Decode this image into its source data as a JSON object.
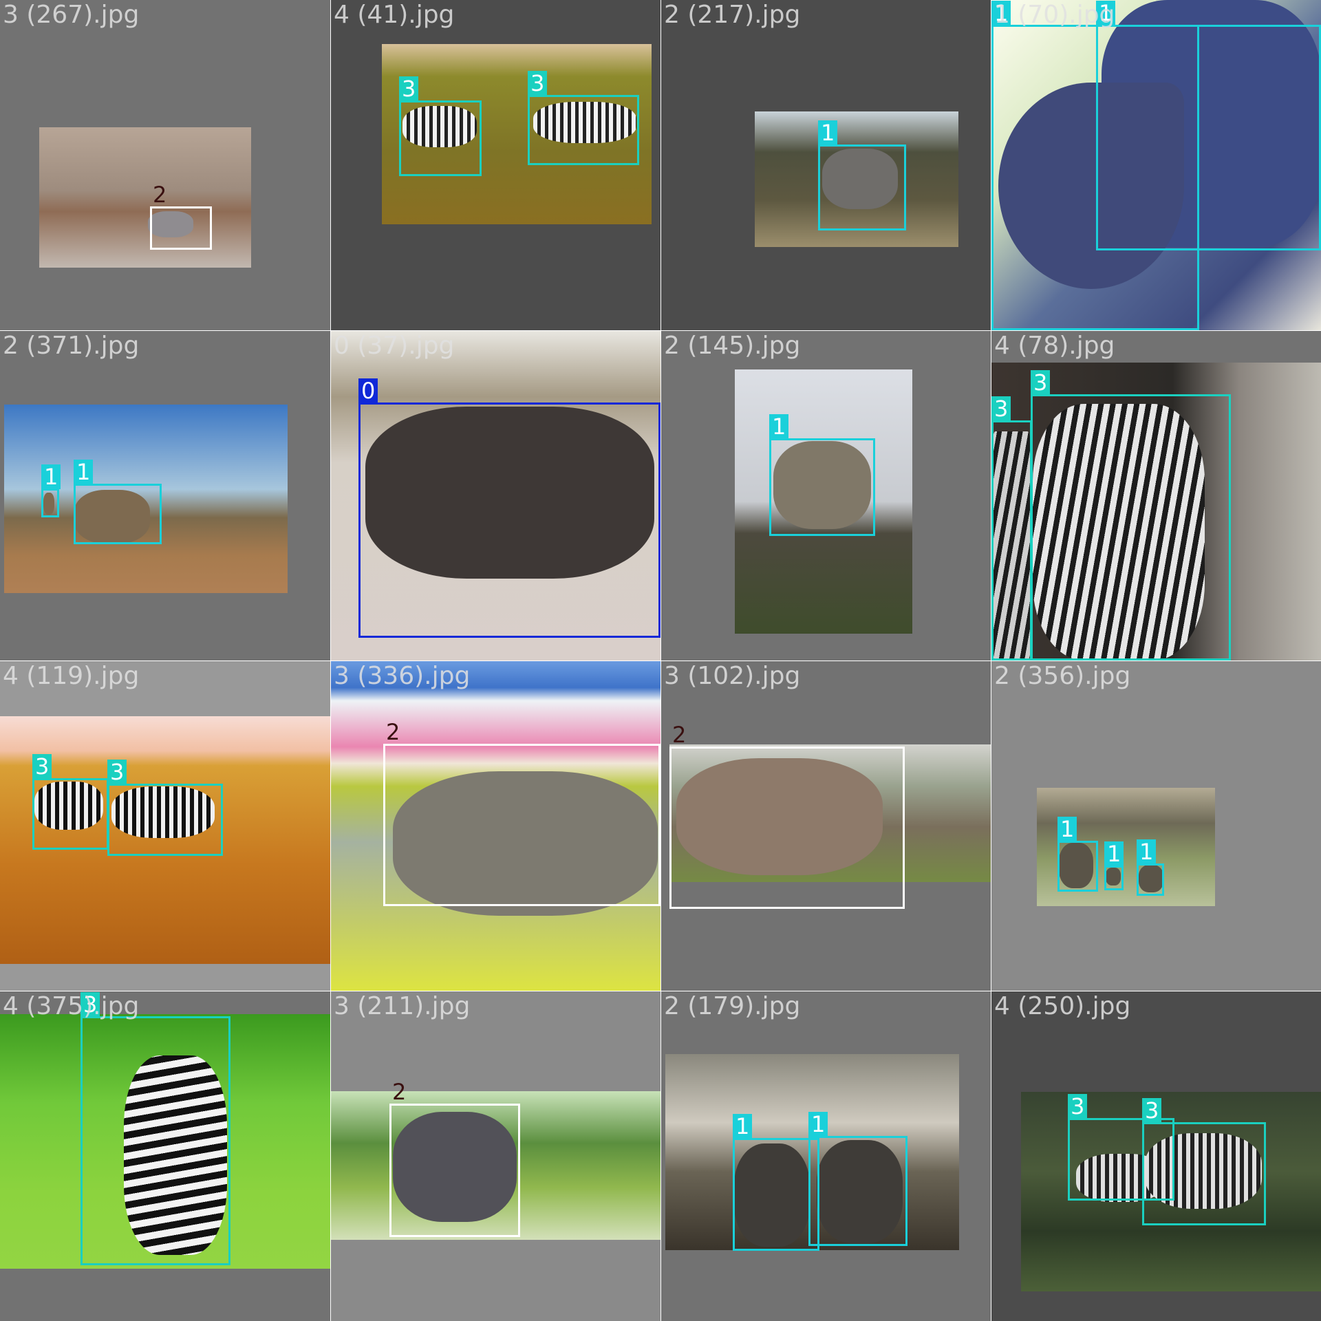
{
  "colors": {
    "class_0": "#1028d8",
    "class_1": "#1ad0da",
    "class_2": "#ffffff",
    "class_3": "#1ad0c0"
  },
  "tiles": [
    {
      "filename": "3 (267).jpg",
      "labels": [
        "2"
      ]
    },
    {
      "filename": "4 (41).jpg",
      "labels": [
        "3",
        "3"
      ]
    },
    {
      "filename": "2 (217).jpg",
      "labels": [
        "1"
      ]
    },
    {
      "filename": "1 (70).jpg",
      "labels": [
        "1",
        "1"
      ]
    },
    {
      "filename": "2 (371).jpg",
      "labels": [
        "1",
        "1"
      ]
    },
    {
      "filename": "0 (37).jpg",
      "labels": [
        "0"
      ]
    },
    {
      "filename": "2 (145).jpg",
      "labels": [
        "1"
      ]
    },
    {
      "filename": "4 (78).jpg",
      "labels": [
        "3",
        "3"
      ]
    },
    {
      "filename": "4 (119).jpg",
      "labels": [
        "3",
        "3"
      ]
    },
    {
      "filename": "3 (336).jpg",
      "labels": [
        "2"
      ]
    },
    {
      "filename": "3 (102).jpg",
      "labels": [
        "2"
      ]
    },
    {
      "filename": "2 (356).jpg",
      "labels": [
        "1",
        "1",
        "1"
      ]
    },
    {
      "filename": "4 (375).jpg",
      "labels": [
        "3"
      ]
    },
    {
      "filename": "3 (211).jpg",
      "labels": [
        "2"
      ]
    },
    {
      "filename": "2 (179).jpg",
      "labels": [
        "1",
        "1"
      ]
    },
    {
      "filename": "4 (250).jpg",
      "labels": [
        "3",
        "3"
      ]
    }
  ]
}
